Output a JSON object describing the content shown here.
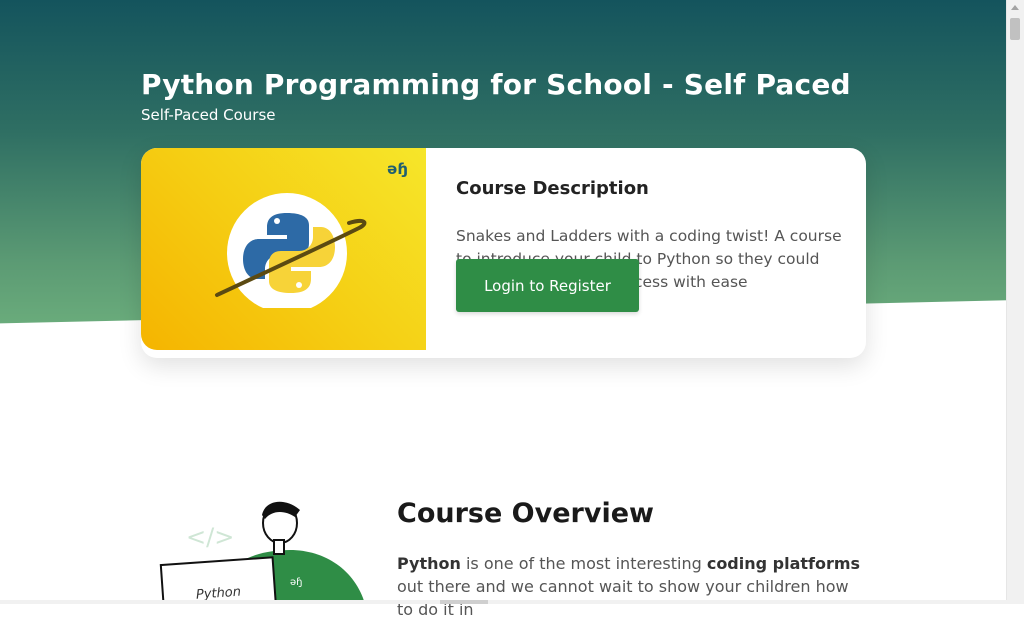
{
  "hero": {
    "title": "Python Programming for School - Self Paced",
    "subtitle": "Self-Paced Course"
  },
  "course_card": {
    "logo_text": "əɧ",
    "emblem_icon": "python-logo-icon",
    "heading": "Course Description",
    "description": "Snakes and Ladders with a coding twist! A course to introduce your child to Python so they could climb the ladder of success with ease",
    "login_button_label": "Login to Register"
  },
  "overview": {
    "illustration_icon": "student-with-laptop-illustration",
    "illustration_code_tag": "</>",
    "illustration_laptop_text": "Python",
    "heading": "Course Overview",
    "text_part1": "Python",
    "text_part2": " is one of the most interesting ",
    "text_part3": "coding platforms",
    "text_part4": " out there and we cannot wait to show your children how to do it in"
  },
  "colors": {
    "hero_gradient_top": "#14545d",
    "hero_gradient_bottom": "#6bad7c",
    "accent_green": "#2f8d46",
    "banner_yellow": "#f5cf14"
  }
}
